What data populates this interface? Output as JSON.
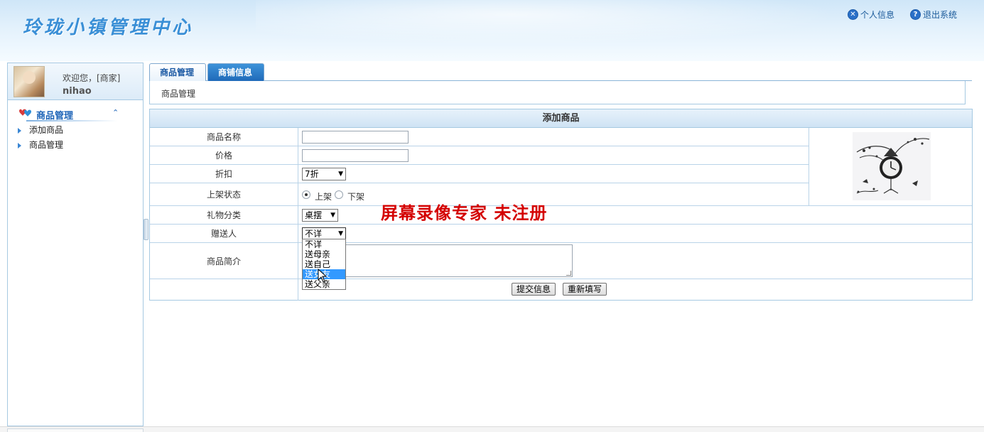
{
  "app": {
    "title": "玲珑小镇管理中心"
  },
  "top_links": [
    {
      "icon": "close-icon",
      "label": "个人信息"
    },
    {
      "icon": "help-icon",
      "label": "退出系统"
    }
  ],
  "user": {
    "welcome": "欢迎您，[商家]",
    "name": "nihao"
  },
  "sidebar": {
    "section_title": "商品管理",
    "items": [
      {
        "label": "添加商品"
      },
      {
        "label": "商品管理"
      }
    ]
  },
  "tabs": [
    {
      "label": "商品管理",
      "active": true
    },
    {
      "label": "商铺信息",
      "active": false
    }
  ],
  "breadcrumb": "商品管理",
  "form": {
    "title": "添加商品",
    "name_label": "商品名称",
    "name_value": "",
    "price_label": "价格",
    "price_value": "",
    "discount_label": "折扣",
    "discount_value": "7折",
    "status_label": "上架状态",
    "status_on": "上架",
    "status_off": "下架",
    "status_selected": "上架",
    "gift_label": "礼物分类",
    "gift_value": "桌摆",
    "recipient_label": "赠送人",
    "recipient_value": "不详",
    "recipient_options": [
      "不详",
      "送母亲",
      "送自己",
      "送女友",
      "送父亲"
    ],
    "recipient_highlighted": "送女友",
    "desc_label": "商品简介",
    "desc_value": "",
    "submit_label": "提交信息",
    "reset_label": "重新填写"
  },
  "watermark": "屏幕录像专家  未注册",
  "colors": {
    "accent": "#1c63b7",
    "tab_inactive": "#2a7acb",
    "border": "#a6c9e2",
    "watermark": "#d40000",
    "highlight": "#3399ff"
  }
}
